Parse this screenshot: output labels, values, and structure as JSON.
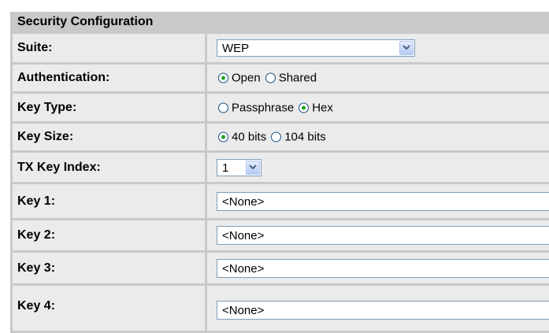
{
  "section": {
    "title": "Security Configuration"
  },
  "rows": {
    "suite": {
      "label": "Suite:",
      "value": "WEP"
    },
    "authentication": {
      "label": "Authentication:",
      "options": [
        "Open",
        "Shared"
      ],
      "selected": "Open"
    },
    "key_type": {
      "label": "Key Type:",
      "options": [
        "Passphrase",
        "Hex"
      ],
      "selected": "Hex"
    },
    "key_size": {
      "label": "Key Size:",
      "options": [
        "40 bits",
        "104 bits"
      ],
      "selected": "40 bits"
    },
    "tx_key_index": {
      "label": "TX Key Index:",
      "value": "1"
    },
    "key1": {
      "label": "Key 1:",
      "value": "<None>"
    },
    "key2": {
      "label": "Key 2:",
      "value": "<None>"
    },
    "key3": {
      "label": "Key 3:",
      "value": "<None>"
    },
    "key4": {
      "label": "Key 4:",
      "value": "<None>"
    }
  },
  "icons": {
    "dropdown": "chevron-down-icon"
  }
}
